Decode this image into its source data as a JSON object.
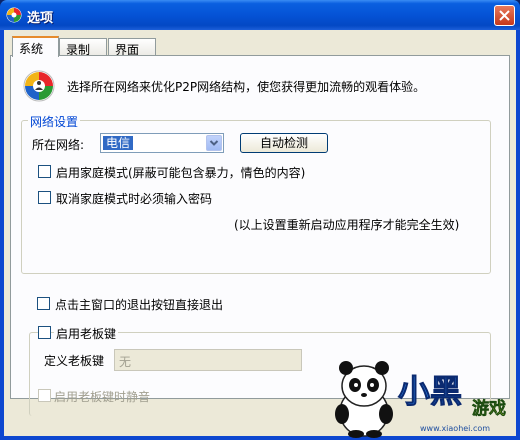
{
  "window": {
    "title": "选项"
  },
  "tabs": [
    {
      "label": "系统"
    },
    {
      "label": "录制"
    },
    {
      "label": "界面"
    }
  ],
  "intro": "选择所在网络来优化P2P网络结构，使您获得更加流畅的观看体验。",
  "network_group": {
    "legend": "网络设置",
    "network_label": "所在网络:",
    "network_value": "电信",
    "auto_detect": "自动检测",
    "family_mode": "启用家庭模式(屏蔽可能包含暴力，情色的内容)",
    "cancel_password": "取消家庭模式时必须输入密码",
    "note": "(以上设置重新启动应用程序才能完全生效)"
  },
  "exit_on_close": "点击主窗口的退出按钮直接退出",
  "boss_group": {
    "legend": "启用老板键",
    "define_label": "定义老板键",
    "key_value": "无",
    "mute_label": "启用老板键时静音"
  },
  "watermark": {
    "line1": "小黑",
    "line2": "游戏",
    "line3": "www.xiaohei.com"
  },
  "colors": {
    "title_bar": "#0553d6",
    "accent": "#0046d5",
    "selection": "#316ac5"
  }
}
